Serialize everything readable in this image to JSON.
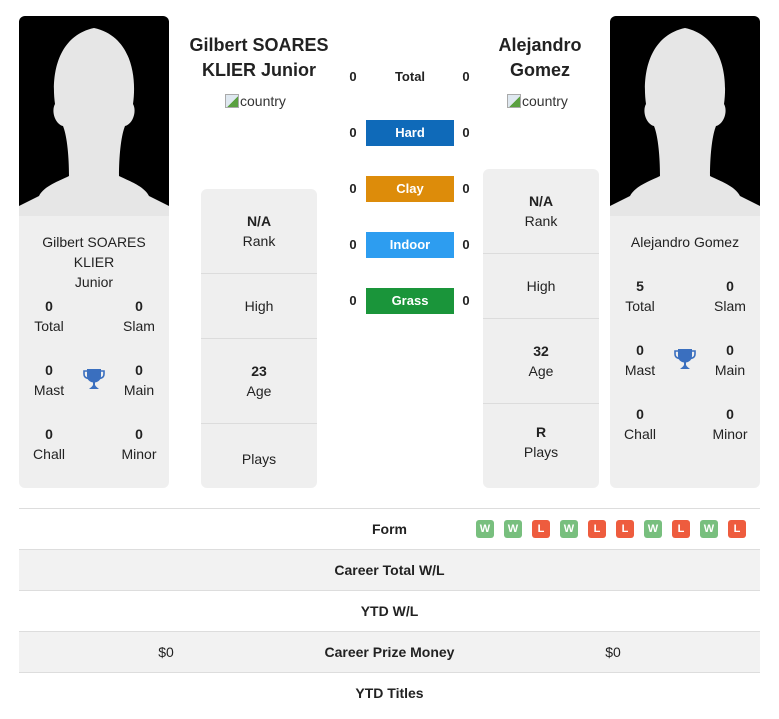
{
  "colors": {
    "hard": "#0f6ab9",
    "clay": "#dd8c0a",
    "indoor": "#2d9df0",
    "grass": "#1a953a",
    "win": "#78bf7e",
    "loss": "#ee5c3e",
    "trophy": "#3a6fbf"
  },
  "player1": {
    "header_name_line1": "Gilbert SOARES",
    "header_name_line2": "KLIER Junior",
    "country_alt": "country",
    "card_name_line1": "Gilbert SOARES KLIER",
    "card_name_line2": "Junior",
    "stats": {
      "total": {
        "value": "0",
        "label": "Total"
      },
      "slam": {
        "value": "0",
        "label": "Slam"
      },
      "mast": {
        "value": "0",
        "label": "Mast"
      },
      "main": {
        "value": "0",
        "label": "Main"
      },
      "chall": {
        "value": "0",
        "label": "Chall"
      },
      "minor": {
        "value": "0",
        "label": "Minor"
      }
    },
    "info": {
      "rank": {
        "value": "N/A",
        "label": "Rank"
      },
      "high": {
        "value": "",
        "label": "High"
      },
      "age": {
        "value": "23",
        "label": "Age"
      },
      "plays": {
        "value": "",
        "label": "Plays"
      }
    }
  },
  "player2": {
    "header_name_line1": "Alejandro",
    "header_name_line2": "Gomez",
    "country_alt": "country",
    "card_name_line1": "Alejandro Gomez",
    "stats": {
      "total": {
        "value": "5",
        "label": "Total"
      },
      "slam": {
        "value": "0",
        "label": "Slam"
      },
      "mast": {
        "value": "0",
        "label": "Mast"
      },
      "main": {
        "value": "0",
        "label": "Main"
      },
      "chall": {
        "value": "0",
        "label": "Chall"
      },
      "minor": {
        "value": "0",
        "label": "Minor"
      }
    },
    "info": {
      "rank": {
        "value": "N/A",
        "label": "Rank"
      },
      "high": {
        "value": "",
        "label": "High"
      },
      "age": {
        "value": "32",
        "label": "Age"
      },
      "plays": {
        "value": "R",
        "label": "Plays"
      }
    }
  },
  "h2h": [
    {
      "label": "Total",
      "p1": "0",
      "p2": "0"
    },
    {
      "label": "Hard",
      "p1": "0",
      "p2": "0"
    },
    {
      "label": "Clay",
      "p1": "0",
      "p2": "0"
    },
    {
      "label": "Indoor",
      "p1": "0",
      "p2": "0"
    },
    {
      "label": "Grass",
      "p1": "0",
      "p2": "0"
    }
  ],
  "table": {
    "rows": [
      {
        "label": "Form",
        "left": "",
        "right": ""
      },
      {
        "label": "Career Total W/L",
        "left": "",
        "right": ""
      },
      {
        "label": "YTD W/L",
        "left": "",
        "right": ""
      },
      {
        "label": "Career Prize Money",
        "left": "$0",
        "right": "$0"
      },
      {
        "label": "YTD Titles",
        "left": "",
        "right": ""
      }
    ],
    "form_p2": [
      "W",
      "W",
      "L",
      "W",
      "L",
      "L",
      "W",
      "L",
      "W",
      "L"
    ]
  }
}
